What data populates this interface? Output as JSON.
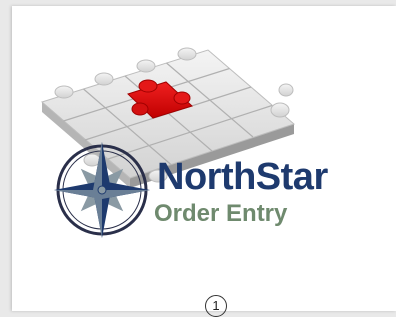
{
  "brand": {
    "name": "NorthStar",
    "subtitle": "Order Entry",
    "name_color": "#1e3a6e",
    "subtitle_color": "#6f8a6e"
  },
  "illustration": {
    "puzzle_icon": "puzzle-grid-icon",
    "highlight_color": "#e01010",
    "piece_color": "#e4e4e4"
  },
  "logo_icon": "compass-rose-icon",
  "page": {
    "number": "1"
  }
}
